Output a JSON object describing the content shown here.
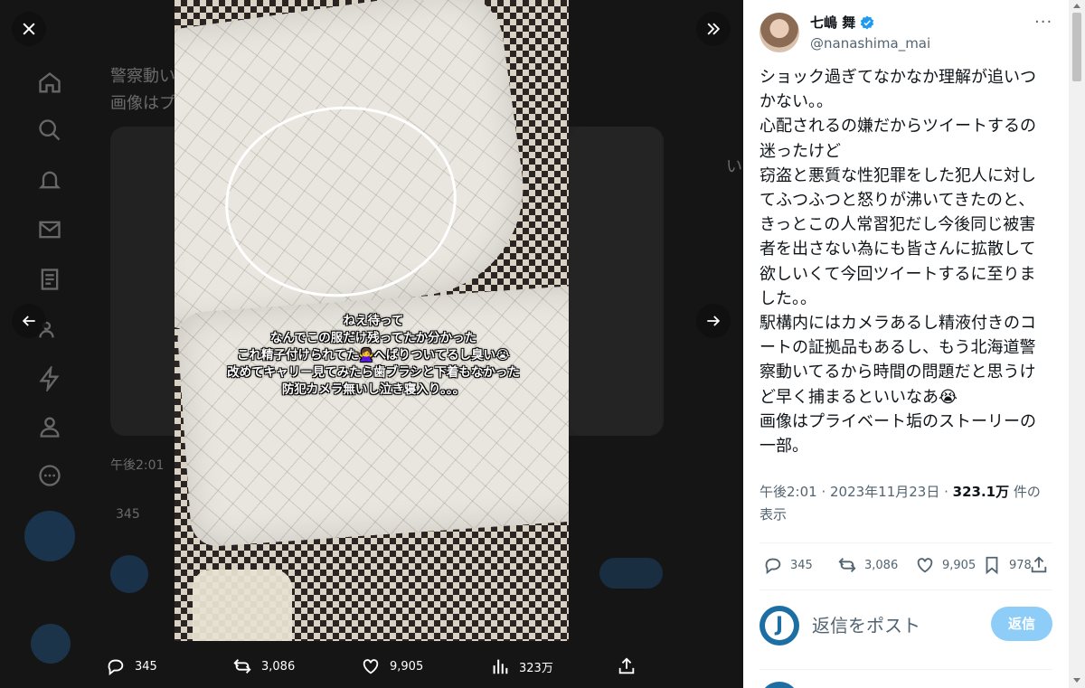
{
  "background": {
    "text_fragments": [
      "警察動い",
      "画像はプ",
      "午後2:01",
      "いま",
      "345"
    ]
  },
  "media": {
    "story_lines": [
      "ねえ待って",
      "なんでこの服だけ残ってたか分かった",
      "これ精子付けられてた🙅‍♀️へばりついてるし臭い😭",
      "改めてキャリー見てみたら歯ブラシと下着もなかった",
      "防犯カメラ無いし泣き寝入り。。。"
    ]
  },
  "overlay": {
    "replies": "345",
    "reposts": "3,086",
    "likes": "9,905",
    "views": "323万"
  },
  "tweet": {
    "display_name": "七嶋 舞",
    "handle": "@nanashima_mai",
    "more": "···",
    "text_lines": [
      "ショック過ぎてなかなか理解が追いつかない。。",
      "心配されるの嫌だからツイートするの迷ったけど",
      "窃盗と悪質な性犯罪をした犯人に対してふつふつと怒りが沸いてきたのと、きっとこの人常習犯だし今後同じ被害者を出さない為にも皆さんに拡散して欲しいくて今回ツイートするに至りました。。",
      "駅構内にはカメラあるし精液付きのコートの証拠品もあるし、もう北海道警察動いてるから時間の問題だと思うけど早く捕まるといいなあ😭",
      "画像はプライベート垢のストーリーの一部。"
    ],
    "time": "午後2:01 · 2023年11月23日 · ",
    "views_count": "323.1万",
    "views_label": " 件の表示",
    "replies": "345",
    "reposts": "3,086",
    "likes": "9,905",
    "bookmarks": "978"
  },
  "reply": {
    "avatar_letter": "J",
    "placeholder": "返信をポスト",
    "button_label": "返信"
  },
  "colors": {
    "accent": "#1d9bf0",
    "reply_button_disabled": "#8ecdf8",
    "panel_bg": "#ffffff",
    "backdrop": "#0e0e0e"
  }
}
